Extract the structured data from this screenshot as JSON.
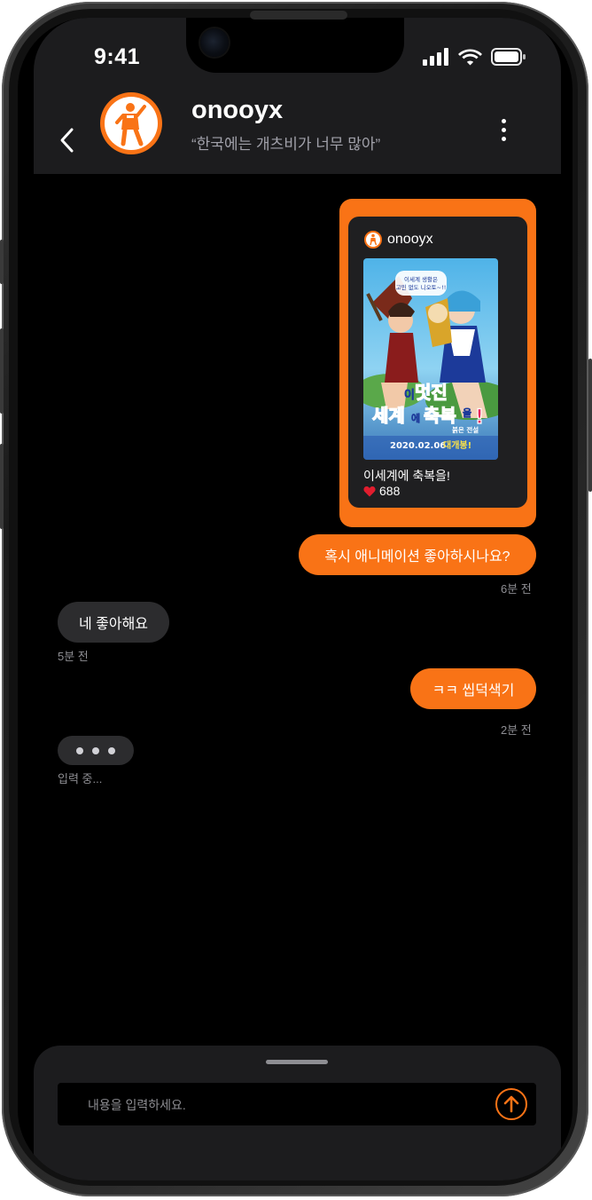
{
  "status_bar": {
    "time": "9:41"
  },
  "header": {
    "user_name": "onooyx",
    "user_status": "“한국에는 개츠비가 너무 많아”"
  },
  "shared_post": {
    "username": "onooyx",
    "poster_title_lines": [
      "이",
      "멋진",
      "세계에",
      "축복을!"
    ],
    "poster_subtitle": "붉은 전설",
    "poster_date": "2020.02.06 대개봉!",
    "poster_tagline": "이세계 생활은 고민 일 없도 니오토~!!",
    "title": "이세계에 축복을!",
    "likes": "688"
  },
  "messages": [
    {
      "direction": "out",
      "text": "혹시 애니메이션 좋아하시나요?",
      "time": "6분 전"
    },
    {
      "direction": "in",
      "text": "네 좋아해요",
      "time": "5분 전"
    },
    {
      "direction": "out",
      "text": "ㅋㅋ 씹덕색기",
      "time": "2분 전"
    }
  ],
  "typing": {
    "label": "입력 중..."
  },
  "composer": {
    "placeholder": "내용을 입력하세요."
  },
  "colors": {
    "accent": "#f97316",
    "background": "#000000",
    "header_bg": "#1c1c1e",
    "incoming_bubble": "#2c2c2e",
    "muted_text": "#8e8e93"
  },
  "icons": {
    "back": "chevron-left-icon",
    "more": "more-vertical-icon",
    "send": "arrow-up-circle-icon",
    "like": "heart-icon",
    "signal": "signal-icon",
    "wifi": "wifi-icon",
    "battery": "battery-icon"
  }
}
